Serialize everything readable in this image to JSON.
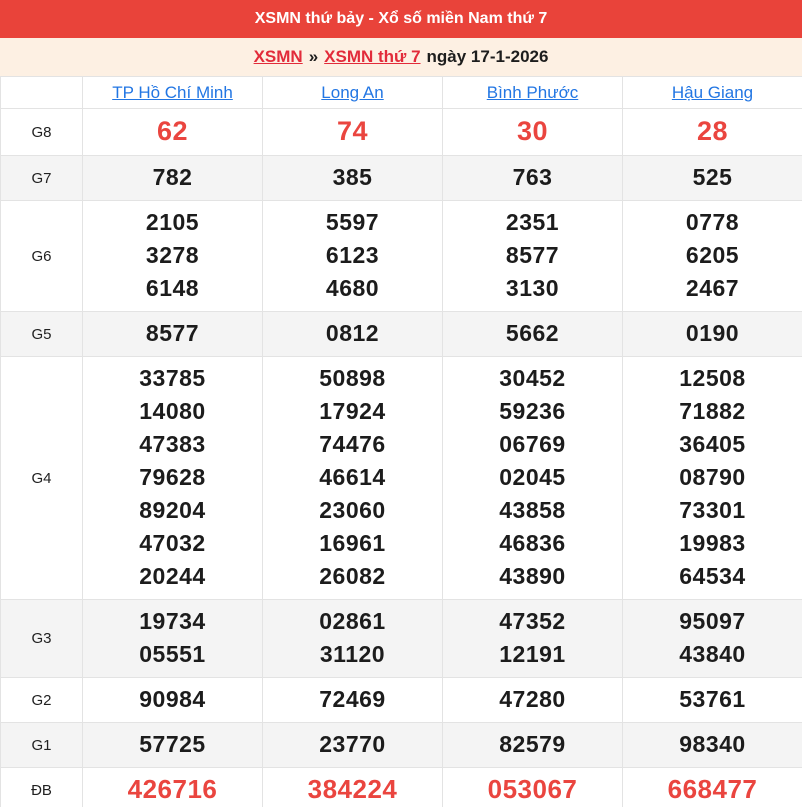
{
  "titlebar": {
    "title": "XSMN thứ bảy - Xổ số miền Nam thứ 7"
  },
  "breadcrumb": {
    "link1": "XSMN",
    "separator": "»",
    "link2": "XSMN thứ 7",
    "date_text": "ngày 17-1-2026"
  },
  "colors": {
    "accent_red": "#e9433a",
    "link_red": "#e22b3a",
    "number_red": "#ea453f",
    "link_blue": "#2276e3",
    "stripe_gray": "#f4f4f4",
    "breadcrumb_bg": "#fdf0e3",
    "border_gray": "#e3e3e3"
  },
  "table": {
    "provinces": [
      "TP Hồ Chí Minh",
      "Long An",
      "Bình Phước",
      "Hậu Giang"
    ],
    "rows": [
      {
        "prize": "G8",
        "highlight": "g8",
        "values": [
          [
            "62"
          ],
          [
            "74"
          ],
          [
            "30"
          ],
          [
            "28"
          ]
        ]
      },
      {
        "prize": "G7",
        "highlight": "",
        "values": [
          [
            "782"
          ],
          [
            "385"
          ],
          [
            "763"
          ],
          [
            "525"
          ]
        ]
      },
      {
        "prize": "G6",
        "highlight": "",
        "values": [
          [
            "2105",
            "3278",
            "6148"
          ],
          [
            "5597",
            "6123",
            "4680"
          ],
          [
            "2351",
            "8577",
            "3130"
          ],
          [
            "0778",
            "6205",
            "2467"
          ]
        ]
      },
      {
        "prize": "G5",
        "highlight": "",
        "values": [
          [
            "8577"
          ],
          [
            "0812"
          ],
          [
            "5662"
          ],
          [
            "0190"
          ]
        ]
      },
      {
        "prize": "G4",
        "highlight": "",
        "values": [
          [
            "33785",
            "14080",
            "47383",
            "79628",
            "89204",
            "47032",
            "20244"
          ],
          [
            "50898",
            "17924",
            "74476",
            "46614",
            "23060",
            "16961",
            "26082"
          ],
          [
            "30452",
            "59236",
            "06769",
            "02045",
            "43858",
            "46836",
            "43890"
          ],
          [
            "12508",
            "71882",
            "36405",
            "08790",
            "73301",
            "19983",
            "64534"
          ]
        ]
      },
      {
        "prize": "G3",
        "highlight": "",
        "values": [
          [
            "19734",
            "05551"
          ],
          [
            "02861",
            "31120"
          ],
          [
            "47352",
            "12191"
          ],
          [
            "95097",
            "43840"
          ]
        ]
      },
      {
        "prize": "G2",
        "highlight": "",
        "values": [
          [
            "90984"
          ],
          [
            "72469"
          ],
          [
            "47280"
          ],
          [
            "53761"
          ]
        ]
      },
      {
        "prize": "G1",
        "highlight": "",
        "values": [
          [
            "57725"
          ],
          [
            "23770"
          ],
          [
            "82579"
          ],
          [
            "98340"
          ]
        ]
      },
      {
        "prize": "ĐB",
        "highlight": "db",
        "values": [
          [
            "426716"
          ],
          [
            "384224"
          ],
          [
            "053067"
          ],
          [
            "668477"
          ]
        ]
      }
    ]
  }
}
